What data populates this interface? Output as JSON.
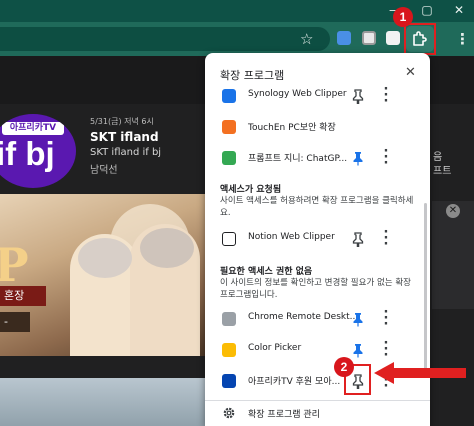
{
  "chrome": {
    "star_glyph": "☆",
    "kebab_glyph": "⋮",
    "accent": "#1f6a5a",
    "window_controls": [
      "—",
      "▢",
      "✕"
    ]
  },
  "annotations": {
    "step1": "1",
    "step2": "2",
    "color": "#e02020"
  },
  "page": {
    "channel_logo_top": "아프리카TV",
    "channel_logo_big": "if bj",
    "date": "5/31(금) 저녁 6시",
    "title": "SKT ifland",
    "subtitle": "SKT ifland if bj",
    "author": "남덕선",
    "right_text_1": "음",
    "right_text_2": "프트",
    "banner_letter": "P",
    "banner_tag_1": "혼장",
    "banner_tag_2": "-"
  },
  "popup": {
    "title": "확장 프로그램",
    "close": "✕",
    "pinned_extensions": [
      {
        "name": "Synology Web Clipper",
        "icon": "synology-icon",
        "pinned": false
      },
      {
        "name": "TouchEn PC보안 확장",
        "icon": "touchen-icon",
        "pinned": false
      },
      {
        "name": "프롬프트 지니: ChatGP...",
        "icon": "prompt-genie-icon",
        "pinned": true
      }
    ],
    "section_access": {
      "title": "액세스가 요청됨",
      "desc": "사이트 액세스를 허용하려면 확장 프로그램을 클릭하세요.",
      "items": [
        {
          "name": "Notion Web Clipper",
          "icon": "notion-icon",
          "pinned": false
        }
      ]
    },
    "section_noaccess": {
      "title": "필요한 액세스 권한 없음",
      "desc": "이 사이트의 정보를 확인하고 변경할 필요가 없는 확장 프로그램입니다.",
      "items": [
        {
          "name": "Chrome Remote Deskt...",
          "icon": "chrome-remote-desktop-icon",
          "pinned": true
        },
        {
          "name": "Color Picker",
          "icon": "color-picker-icon",
          "pinned": true
        },
        {
          "name": "아프리카TV 후원 모아...",
          "icon": "afreecatv-icon",
          "pinned": false
        }
      ]
    },
    "manage_label": "확장 프로그램 관리"
  }
}
